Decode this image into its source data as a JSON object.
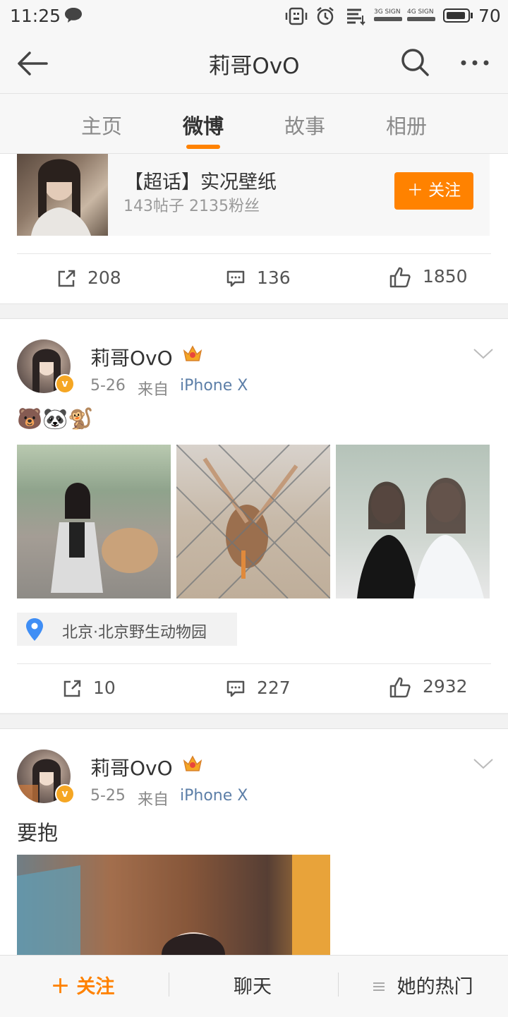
{
  "status_bar": {
    "time": "11:25",
    "battery": "70"
  },
  "header": {
    "title": "莉哥OvO"
  },
  "tabs": [
    "主页",
    "微博",
    "故事",
    "相册"
  ],
  "super_topic": {
    "name": "【超话】实况壁纸",
    "meta": "143帖子  2135粉丝",
    "follow_label": "关注"
  },
  "post1_actions": {
    "repost": "208",
    "comment": "136",
    "like": "1850"
  },
  "post2": {
    "user": "莉哥OvO",
    "date": "5-26",
    "from": "来自",
    "source": "iPhone X",
    "text": "🐻🐼🐒",
    "location": "北京·北京野生动物园",
    "repost": "10",
    "comment": "227",
    "like": "2932"
  },
  "post3": {
    "user": "莉哥OvO",
    "date": "5-25",
    "from": "来自",
    "source": "iPhone X",
    "text": "要抱"
  },
  "bottom_bar": {
    "follow": "关注",
    "chat": "聊天",
    "hot": "她的热门"
  },
  "colors": {
    "accent": "#ff8200",
    "link": "#5d7fa8"
  }
}
